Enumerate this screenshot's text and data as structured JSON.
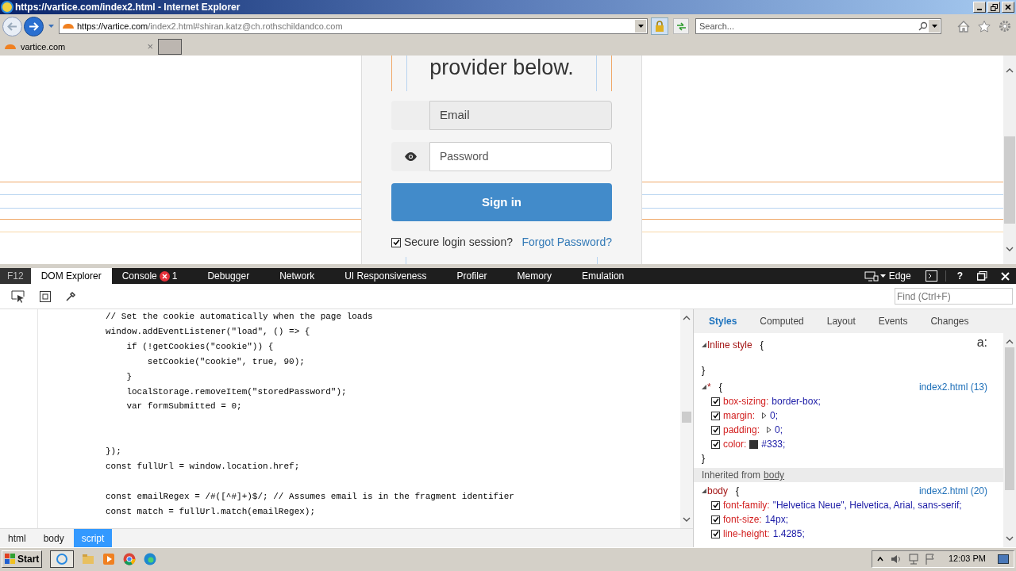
{
  "window": {
    "title": "https://vartice.com/index2.html - Internet Explorer"
  },
  "address_bar": {
    "url_host": "https://vartice.com",
    "url_rest": "/index2.html#shiran.katz@ch.rothschildandco.com"
  },
  "search": {
    "placeholder": "Search..."
  },
  "browser_tabs": [
    {
      "label": "vartice.com",
      "close": "×",
      "selected": true
    }
  ],
  "page": {
    "heading": "provider below.",
    "fields": [
      {
        "kind": "email",
        "placeholder": "Email"
      },
      {
        "kind": "password",
        "placeholder": "Password"
      }
    ],
    "sign_in": "Sign in",
    "remember": {
      "label": "Secure login session?",
      "checked": true
    },
    "forgot": "Forgot Password?"
  },
  "devtools": {
    "label": "F12",
    "tabs": [
      {
        "label": "DOM Explorer",
        "selected": true
      },
      {
        "label": "Console",
        "selected": false,
        "errors": "1"
      },
      {
        "label": "Debugger",
        "selected": false
      },
      {
        "label": "Network",
        "selected": false
      },
      {
        "label": "UI Responsiveness",
        "selected": false
      },
      {
        "label": "Profiler",
        "selected": false
      },
      {
        "label": "Memory",
        "selected": false
      },
      {
        "label": "Emulation",
        "selected": false
      }
    ],
    "mode": "Edge",
    "help": "?",
    "find": {
      "placeholder": "Find (Ctrl+F)"
    },
    "code_lines": [
      {
        "kind": "code",
        "text": "// Set the cookie automatically when the page loads"
      },
      {
        "kind": "code",
        "text": "window.addEventListener(\"load\", () => {"
      },
      {
        "kind": "code",
        "text": "    if (!getCookies(\"cookie\")) {"
      },
      {
        "kind": "code",
        "text": "        setCookie(\"cookie\", true, 90);"
      },
      {
        "kind": "code",
        "text": "    }"
      },
      {
        "kind": "code",
        "text": "    localStorage.removeItem(\"storedPassword\");"
      },
      {
        "kind": "code",
        "text": "    var formSubmitted = 0;"
      },
      {
        "kind": "blank"
      },
      {
        "kind": "blank"
      },
      {
        "kind": "code",
        "text": "});"
      },
      {
        "kind": "code",
        "text": "const fullUrl = window.location.href;"
      },
      {
        "kind": "blank"
      },
      {
        "kind": "code",
        "text": "const emailRegex = /#([^#]+)$/; // Assumes email is in the fragment identifier"
      },
      {
        "kind": "code",
        "text": "const match = fullUrl.match(emailRegex);"
      }
    ],
    "breadcrumbs": [
      {
        "label": "html",
        "selected": false
      },
      {
        "label": "body",
        "selected": false
      },
      {
        "label": "script",
        "selected": true
      }
    ],
    "style_tabs": [
      {
        "label": "Styles",
        "selected": true
      },
      {
        "label": "Computed",
        "selected": false
      },
      {
        "label": "Layout",
        "selected": false
      },
      {
        "label": "Events",
        "selected": false
      },
      {
        "label": "Changes",
        "selected": false
      }
    ],
    "pseudo_toggle": "a:",
    "rules": [
      {
        "kind": "rule",
        "selector": "Inline style",
        "open": "{",
        "close": "}"
      },
      {
        "kind": "rule",
        "selector": "*",
        "open": "{",
        "close": "}",
        "source": "index2.html (13)",
        "props": [
          {
            "name": "box-sizing:",
            "value": "border-box;",
            "checked": true
          },
          {
            "name": "margin:",
            "value": "0;",
            "checked": true,
            "expandable": true
          },
          {
            "name": "padding:",
            "value": "0;",
            "checked": true,
            "expandable": true
          },
          {
            "name": "color:",
            "value": "#333;",
            "checked": true,
            "color": "#333333"
          }
        ]
      },
      {
        "kind": "inherited",
        "prefix": "Inherited from",
        "element": "body"
      },
      {
        "kind": "rule",
        "selector": "body",
        "open": "{",
        "source": "index2.html (20)",
        "props": [
          {
            "name": "font-family:",
            "value": "\"Helvetica Neue\", Helvetica, Arial, sans-serif;",
            "checked": true
          },
          {
            "name": "font-size:",
            "value": "14px;",
            "checked": true
          },
          {
            "name": "line-height:",
            "value": "1.4285;",
            "checked": true
          }
        ]
      }
    ]
  },
  "taskbar": {
    "start": "Start",
    "time": "12:03 PM"
  }
}
